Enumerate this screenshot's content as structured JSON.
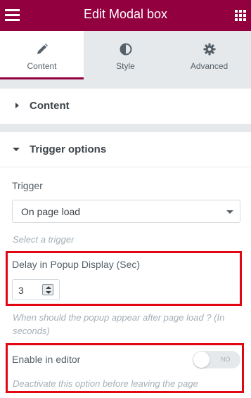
{
  "header": {
    "title": "Edit Modal box",
    "menu_icon": "hamburger-icon",
    "apps_icon": "grid-icon",
    "background_color": "#93003f"
  },
  "tabs": [
    {
      "label": "Content",
      "icon": "pencil-icon",
      "active": true
    },
    {
      "label": "Style",
      "icon": "half-circle-icon",
      "active": false
    },
    {
      "label": "Advanced",
      "icon": "gear-icon",
      "active": false
    }
  ],
  "sections": {
    "content": {
      "title": "Content",
      "expanded": false
    },
    "trigger_options": {
      "title": "Trigger options",
      "expanded": true
    }
  },
  "controls": {
    "trigger": {
      "label": "Trigger",
      "value": "On page load",
      "description": "Select a trigger"
    },
    "delay": {
      "label": "Delay in Popup Display (Sec)",
      "value": "3",
      "description": "When should the popup appear after page load ? (In seconds)"
    },
    "enable_in_editor": {
      "label": "Enable in editor",
      "toggle_text": "NO",
      "enabled": false,
      "description": "Deactivate this option before leaving the page"
    }
  },
  "colors": {
    "highlight": "#e30613",
    "panel_gray": "#e6e9ec",
    "text": "#556068",
    "muted": "#a4afb7"
  }
}
